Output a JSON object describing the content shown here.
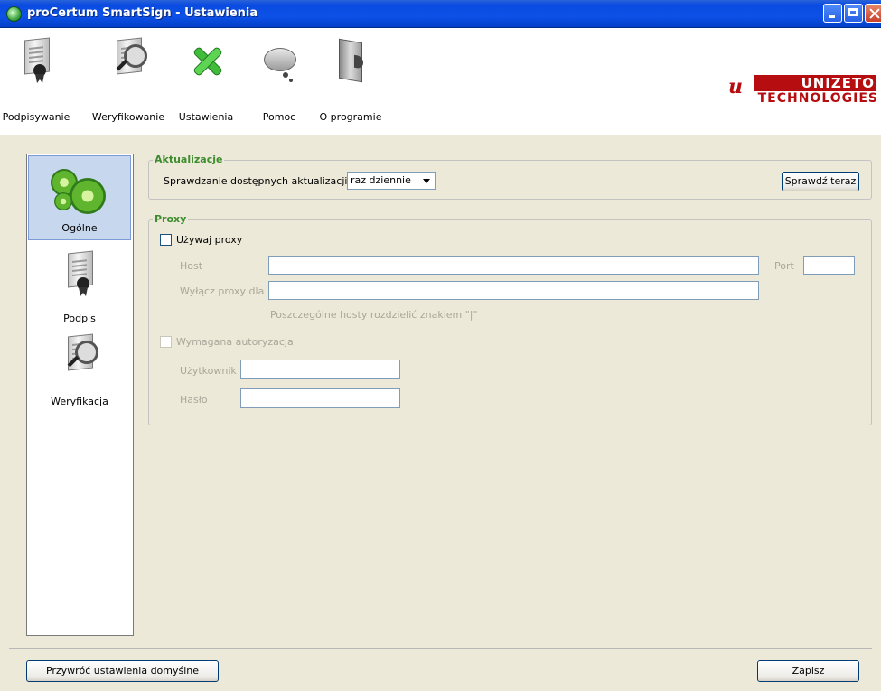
{
  "window": {
    "title": "proCertum SmartSign - Ustawienia"
  },
  "toolbar": {
    "items": [
      {
        "label": "Podpisywanie",
        "icon": "sign-document-icon"
      },
      {
        "label": "Weryfikowanie",
        "icon": "verify-document-icon"
      },
      {
        "label": "Ustawienia",
        "icon": "wrench-icon"
      },
      {
        "label": "Pomoc",
        "icon": "help-bubble-icon"
      },
      {
        "label": "O programie",
        "icon": "about-book-icon"
      }
    ]
  },
  "logo": {
    "line1": "UNIZETO",
    "line2": "TECHNOLOGIES",
    "brand_color": "#b50d10"
  },
  "sidebar": {
    "items": [
      {
        "label": "Ogólne",
        "active": true
      },
      {
        "label": "Podpis",
        "active": false
      },
      {
        "label": "Weryfikacja",
        "active": false
      }
    ]
  },
  "updates": {
    "legend": "Aktualizacje",
    "check_label": "Sprawdzanie dostępnych aktualizacji:",
    "frequency_value": "raz dziennie",
    "check_now_button": "Sprawdź teraz"
  },
  "proxy": {
    "legend": "Proxy",
    "use_proxy_label": "Używaj proxy",
    "use_proxy_checked": false,
    "host_label": "Host",
    "host_value": "",
    "port_label": "Port",
    "port_value": "",
    "bypass_label": "Wyłącz proxy dla",
    "bypass_value": "",
    "bypass_hint": "Poszczególne hosty rozdzielić znakiem \"|\"",
    "auth_label": "Wymagana autoryzacja",
    "auth_checked": false,
    "user_label": "Użytkownik",
    "user_value": "",
    "password_label": "Hasło",
    "password_value": ""
  },
  "footer": {
    "reset_button": "Przywróć ustawienia domyślne",
    "save_button": "Zapisz"
  },
  "colors": {
    "titlebar": "#0d51e8",
    "legend": "#3d8c2e",
    "selection": "#c7d7ee"
  }
}
